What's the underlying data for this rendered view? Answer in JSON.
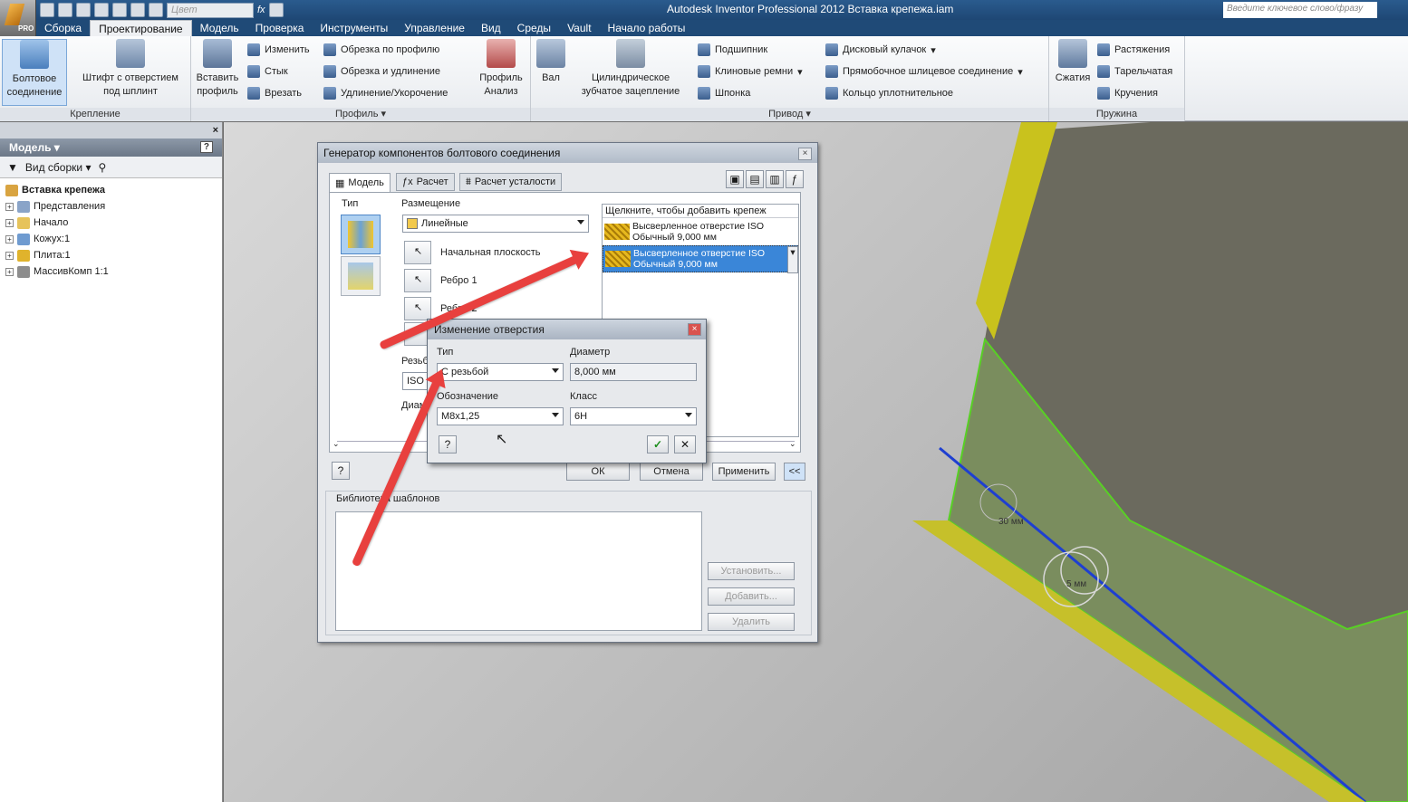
{
  "app": {
    "title": "Autodesk Inventor Professional 2012   Вставка крепежа.iam",
    "pro_label": "PRO"
  },
  "qat": {
    "color_placeholder": "Цвет",
    "fx_label": "fx"
  },
  "search": {
    "placeholder": "Введите ключевое слово/фразу"
  },
  "tabs": [
    "Сборка",
    "Проектирование",
    "Модель",
    "Проверка",
    "Инструменты",
    "Управление",
    "Вид",
    "Среды",
    "Vault",
    "Начало работы"
  ],
  "ribbon": {
    "krepl": {
      "label": "Крепление",
      "bolt": "Болтовое\nсоединение",
      "pin": "Штифт с отверстием\nпод шплинт"
    },
    "profile": {
      "label": "Профиль",
      "insert": "Вставить\nпрофиль",
      "change": "Изменить",
      "joint": "Стык",
      "cut": "Врезать",
      "trim_prof": "Обрезка по профилю",
      "trim_ext": "Обрезка и удлинение",
      "lengthen": "Удлинение/Укорочение",
      "analysis": "Профиль\nАнализ"
    },
    "drive": {
      "label": "Привод",
      "shaft": "Вал",
      "gear": "Цилиндрическое\nзубчатое зацепление",
      "bearing": "Подшипник",
      "vbelt": "Клиновые ремни",
      "key": "Шпонка",
      "cam": "Дисковый кулачок",
      "spline": "Прямобочное шлицевое соединение",
      "oring": "Кольцо уплотнительное"
    },
    "spring": {
      "label": "Пружина",
      "compress": "Сжатия",
      "tension": "Растяжения",
      "disc": "Тарельчатая",
      "torsion": "Кручения"
    }
  },
  "browser": {
    "title": "Модель",
    "view": "Вид сборки",
    "help": "?",
    "tree": [
      {
        "label": "Вставка крепежа",
        "bold": true,
        "indent": 0
      },
      {
        "label": "Представления",
        "indent": 1
      },
      {
        "label": "Начало",
        "indent": 1
      },
      {
        "label": "Кожух:1",
        "indent": 1
      },
      {
        "label": "Плита:1",
        "indent": 1
      },
      {
        "label": "МассивКомп 1:1",
        "indent": 1
      }
    ]
  },
  "dialog": {
    "title": "Генератор компонентов болтового соединения",
    "tabs": [
      "Модель",
      "Расчет",
      "Расчет усталости"
    ],
    "type_label": "Тип",
    "placement_label": "Размещение",
    "placement_value": "Линейные",
    "start_plane": "Начальная плоскость",
    "edge1": "Ребро 1",
    "edge2": "Ребро 2",
    "thread_label": "Резьба",
    "thread_value": "ISO",
    "diam_label": "Диам",
    "list_header": "Щелкните, чтобы добавить крепеж",
    "items": [
      {
        "l1": "Высверленное отверстие ISO",
        "l2": "Обычный 9,000 мм",
        "selected": false
      },
      {
        "l1": "Высверленное отверстие ISO",
        "l2": "Обычный 9,000 мм",
        "selected": true
      }
    ],
    "ok": "ОК",
    "cancel": "Отмена",
    "apply": "Применить",
    "collapse": "<<",
    "library_label": "Библиотека шаблонов",
    "install": "Установить...",
    "add": "Добавить...",
    "delete": "Удалить"
  },
  "subdialog": {
    "title": "Изменение отверстия",
    "type_label": "Тип",
    "type_value": "С резьбой",
    "diam_label": "Диаметр",
    "diam_value": "8,000 мм",
    "desig_label": "Обозначение",
    "desig_value": "M8x1,25",
    "class_label": "Класс",
    "class_value": "6H"
  },
  "viewport": {
    "dim1": "30 мм",
    "dim2": "5 мм"
  },
  "colors": {
    "accent": "#3a86d8",
    "arrow": "#e8403e",
    "titlebar": "#1f4a77"
  }
}
